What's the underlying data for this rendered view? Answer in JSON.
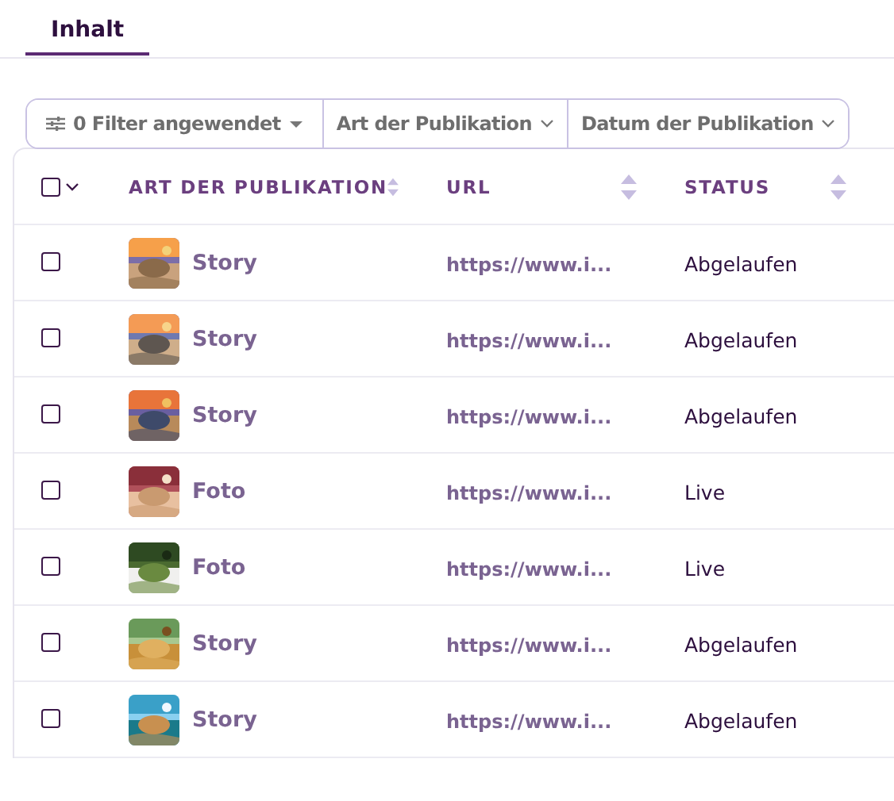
{
  "tabs": [
    {
      "label": "Inhalt",
      "selected": true
    }
  ],
  "filters": [
    {
      "kind": "summary",
      "label": "0 Filter angewendet"
    },
    {
      "kind": "dropdown",
      "label": "Art der Publikation"
    },
    {
      "kind": "dropdown",
      "label": "Datum der Publikation"
    }
  ],
  "table": {
    "select_all": {
      "checked": false
    },
    "columns": [
      {
        "label": "ART DER PUBLIKATION"
      },
      {
        "label": "URL"
      },
      {
        "label": "STATUS"
      }
    ],
    "rows": [
      {
        "checked": false,
        "type": "Story",
        "url": "https://www.i...",
        "status": "Abgelaufen"
      },
      {
        "checked": false,
        "type": "Story",
        "url": "https://www.i...",
        "status": "Abgelaufen"
      },
      {
        "checked": false,
        "type": "Story",
        "url": "https://www.i...",
        "status": "Abgelaufen"
      },
      {
        "checked": false,
        "type": "Foto",
        "url": "https://www.i...",
        "status": "Live"
      },
      {
        "checked": false,
        "type": "Foto",
        "url": "https://www.i...",
        "status": "Live"
      },
      {
        "checked": false,
        "type": "Story",
        "url": "https://www.i...",
        "status": "Abgelaufen"
      },
      {
        "checked": false,
        "type": "Story",
        "url": "https://www.i...",
        "status": "Abgelaufen"
      }
    ]
  }
}
